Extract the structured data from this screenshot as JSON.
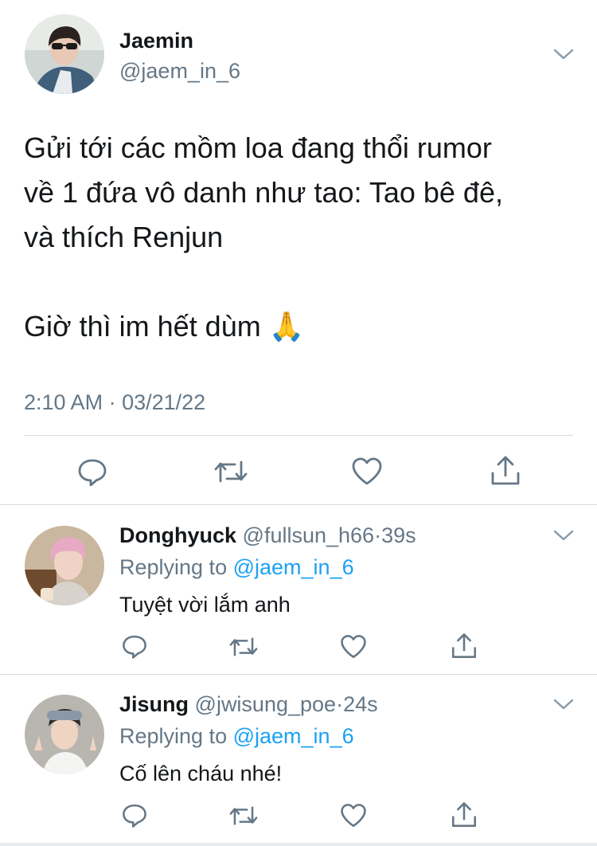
{
  "main_tweet": {
    "author_name": "Jaemin",
    "handle": "@jaem_in_6",
    "text_lines": [
      "Gửi tới các mồm loa đang thổi rumor",
      "về 1 đứa vô danh như tao: Tao bê đê,",
      "và thích Renjun",
      "Giờ thì im hết dùm 🙏"
    ],
    "time": "2:10 AM",
    "date": "03/21/22",
    "separator": "·"
  },
  "replies": [
    {
      "author_name": "Donghyuck",
      "handle": "@fullsun_h66",
      "separator": "·",
      "age": "39s",
      "replying_prefix": "Replying to",
      "replying_to": "@jaem_in_6",
      "text": "Tuyệt vời lắm anh"
    },
    {
      "author_name": "Jisung",
      "handle": "@jwisung_poe",
      "separator": "·",
      "age": "24s",
      "replying_prefix": "Replying to",
      "replying_to": "@jaem_in_6",
      "text": "Cố lên cháu nhé!"
    }
  ],
  "icons": {
    "reply": "comment-icon",
    "retweet": "retweet-icon",
    "like": "heart-icon",
    "share": "share-icon",
    "menu": "chevron-down-icon"
  },
  "colors": {
    "text": "#14171a",
    "muted": "#657786",
    "link": "#1da1f2",
    "divider": "#d6dbe0"
  }
}
